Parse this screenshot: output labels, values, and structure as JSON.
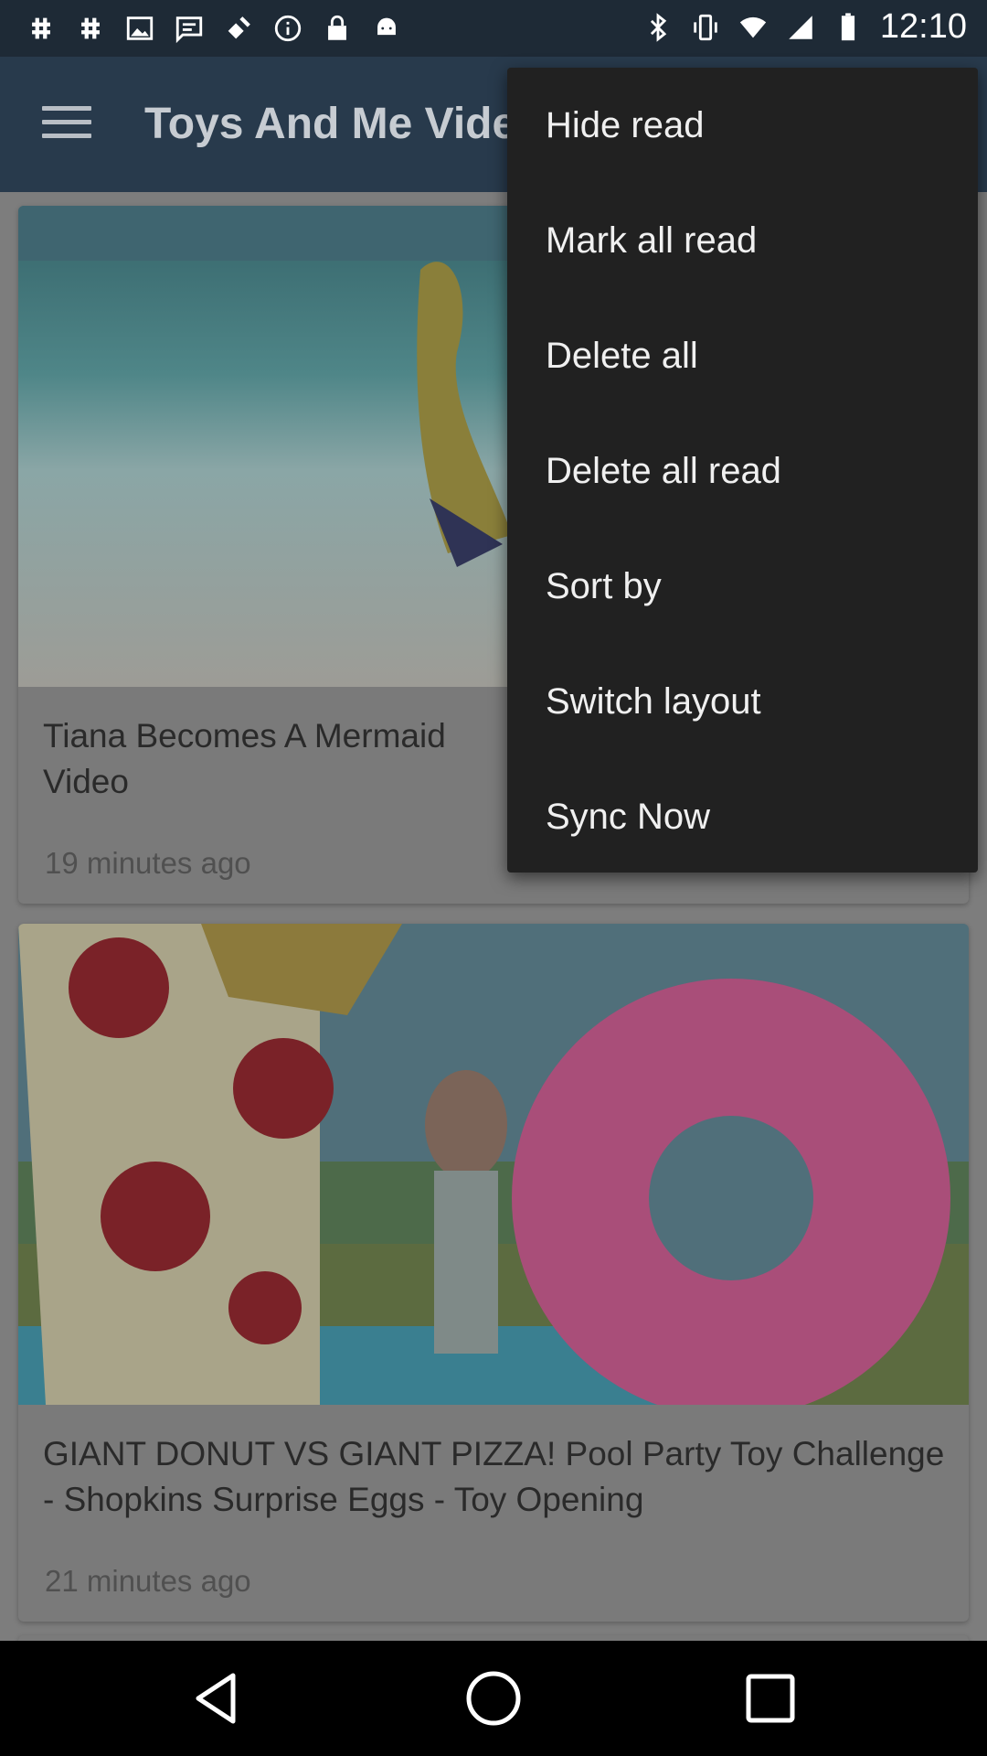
{
  "status_bar": {
    "time": "12:10",
    "left_icons": [
      "hash-icon",
      "hash-icon",
      "image-icon",
      "message-icon",
      "satellite-icon",
      "info-icon",
      "lock-icon",
      "android-icon"
    ],
    "right_icons": [
      "bluetooth-icon",
      "vibrate-icon",
      "wifi-icon",
      "signal-icon",
      "battery-icon"
    ]
  },
  "app_bar": {
    "title": "Toys And Me Vide",
    "menu_icon": "hamburger-menu-icon"
  },
  "feed": {
    "items": [
      {
        "headline": "Tiana Becomes A Mermaid\nVideo",
        "time": "19 minutes ago"
      },
      {
        "headline": "GIANT DONUT VS GIANT PIZZA! Pool Party Toy Challenge - Shopkins Surprise Eggs - Toy Opening",
        "time": "21 minutes ago"
      }
    ]
  },
  "overflow_menu": {
    "items": [
      {
        "label": "Hide read"
      },
      {
        "label": "Mark all read"
      },
      {
        "label": "Delete all"
      },
      {
        "label": "Delete all read"
      },
      {
        "label": "Sort by"
      },
      {
        "label": "Switch layout"
      },
      {
        "label": "Sync Now"
      }
    ]
  },
  "nav_bar": {
    "buttons": [
      "back-icon",
      "home-icon",
      "recents-icon"
    ]
  }
}
